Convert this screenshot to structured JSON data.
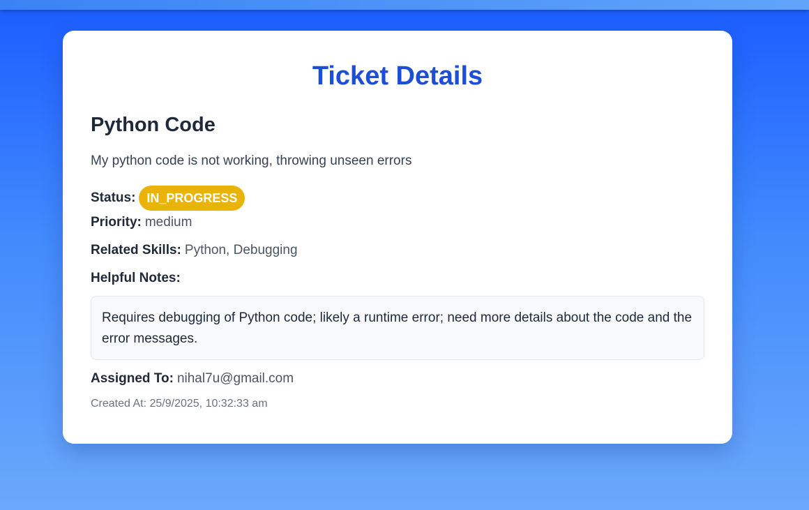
{
  "header": {
    "title": "Ticket Details"
  },
  "ticket": {
    "title": "Python Code",
    "description": "My python code is not working, throwing unseen errors",
    "status": {
      "label": "Status:",
      "value": "IN_PROGRESS",
      "color": "#eab308"
    },
    "priority": {
      "label": "Priority:",
      "value": "medium"
    },
    "skills": {
      "label": "Related Skills:",
      "value": "Python, Debugging"
    },
    "notes": {
      "label": "Helpful Notes:",
      "value": "Requires debugging of Python code; likely a runtime error; need more details about the code and the error messages."
    },
    "assigned": {
      "label": "Assigned To:",
      "value": "nihal7u@gmail.com"
    },
    "created_at": "Created At: 25/9/2025, 10:32:33 am"
  },
  "colors": {
    "accent": "#1d4ed8",
    "background_top": "#1a5cff",
    "background_bottom": "#6aa9fb"
  }
}
